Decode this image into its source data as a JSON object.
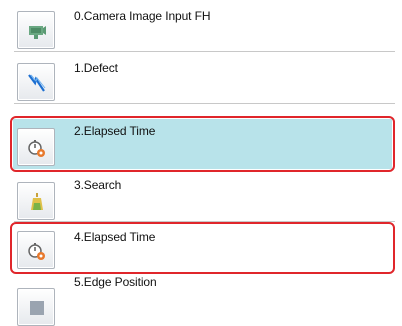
{
  "flow_items": [
    {
      "label": "0.Camera Image Input FH",
      "icon": "camera-image-input-icon"
    },
    {
      "label": "1.Defect",
      "icon": "defect-icon"
    },
    {
      "label": "2.Elapsed Time",
      "icon": "elapsed-time-icon",
      "selected": true,
      "highlighted": true
    },
    {
      "label": "3.Search",
      "icon": "search-icon"
    },
    {
      "label": "4.Elapsed Time",
      "icon": "elapsed-time-icon",
      "highlighted": true
    },
    {
      "label": "5.Edge Position",
      "icon": "edge-position-icon"
    }
  ],
  "colors": {
    "selection_bg": "#b8e3ea",
    "highlight_border": "#e0262b",
    "separator": "#c8c8c8"
  }
}
